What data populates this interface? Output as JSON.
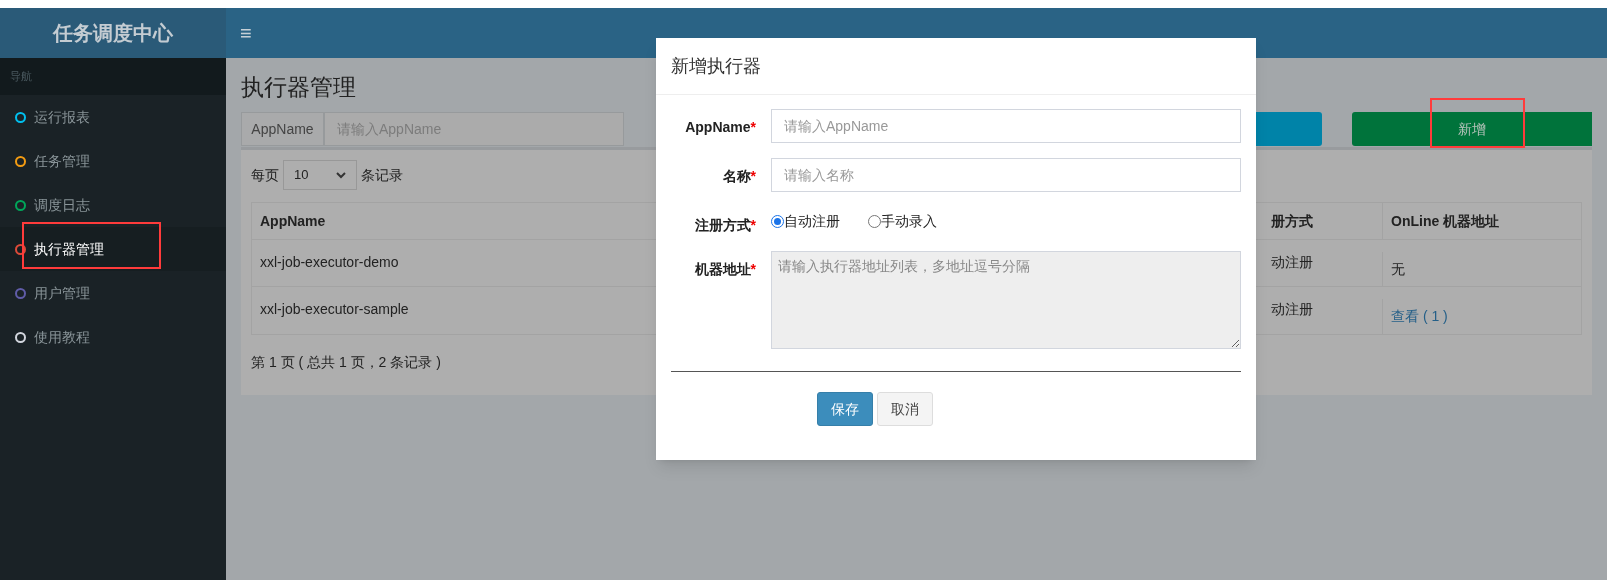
{
  "header": {
    "logo": "任务调度中心",
    "menu_toggle": "≡"
  },
  "sidebar": {
    "heading": "导航",
    "items": [
      {
        "label": "运行报表",
        "color": "#00c0ef",
        "selected": false
      },
      {
        "label": "任务管理",
        "color": "#f39c12",
        "selected": false
      },
      {
        "label": "调度日志",
        "color": "#00a65a",
        "selected": false
      },
      {
        "label": "执行器管理",
        "color": "#dd4b39",
        "selected": true
      },
      {
        "label": "用户管理",
        "color": "#605ca8",
        "selected": false
      },
      {
        "label": "使用教程",
        "color": "#d2d6de",
        "selected": false
      }
    ]
  },
  "page": {
    "title": "执行器管理",
    "search": {
      "label": "AppName",
      "placeholder": "请输入AppName"
    },
    "add_button": "新增",
    "page_size": {
      "prefix": "每页",
      "value": "10",
      "suffix": "条记录"
    },
    "table": {
      "columns": [
        "AppName",
        "册方式",
        "OnLine 机器地址"
      ],
      "rows": [
        [
          "xxl-job-executor-demo",
          "动注册",
          "无"
        ],
        [
          "xxl-job-executor-sample",
          "动注册",
          "查看 ( 1 )"
        ]
      ]
    },
    "pagination": "第 1 页 ( 总共 1 页，2 条记录 )"
  },
  "modal": {
    "title": "新增执行器",
    "fields": [
      {
        "kind": "text",
        "label": "AppName",
        "required_mark": "*",
        "placeholder": "请输入AppName"
      },
      {
        "kind": "text",
        "label": "名称",
        "required_mark": "*",
        "placeholder": "请输入名称"
      },
      {
        "kind": "radio",
        "label": "注册方式",
        "required_mark": "*",
        "options": [
          {
            "label": "自动注册",
            "selected": true
          },
          {
            "label": "手动录入",
            "selected": false
          }
        ]
      },
      {
        "kind": "textarea",
        "label": "机器地址",
        "required_mark": "*",
        "placeholder": "请输入执行器地址列表，多地址逗号分隔",
        "disabled": true
      }
    ],
    "buttons": [
      {
        "label": "保存",
        "primary": true
      },
      {
        "label": "取消",
        "primary": false
      }
    ]
  }
}
